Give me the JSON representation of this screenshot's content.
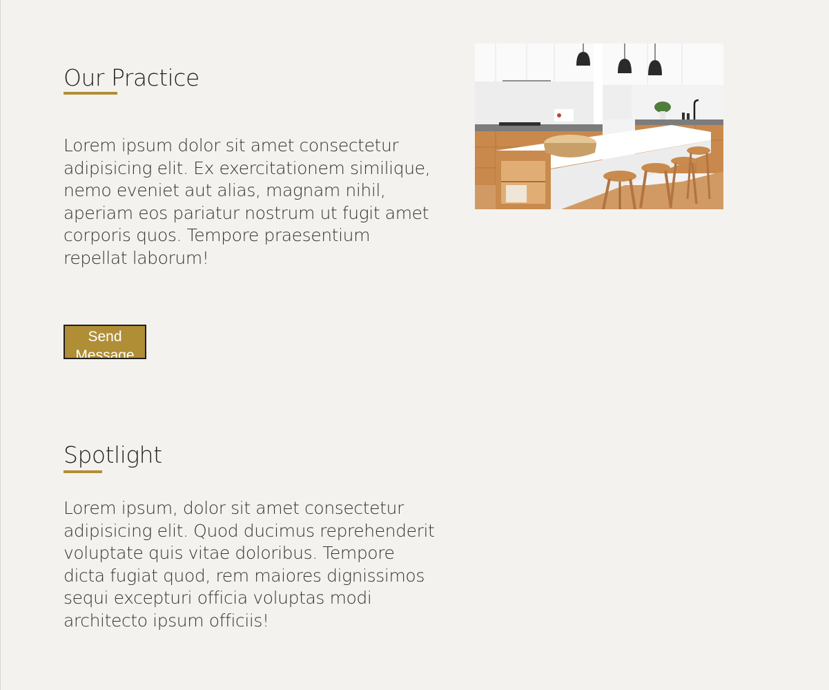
{
  "practice": {
    "heading": "Our Practice",
    "paragraph": "Lorem ipsum dolor sit amet consectetur adipisicing elit. Ex exercitationem similique, nemo eveniet aut alias, magnam nihil, aperiam eos pariatur nostrum ut fugit amet corporis quos. Tempore praesentium repellat laborum!",
    "button_label": "Send Message"
  },
  "spotlight": {
    "heading": "Spotlight",
    "paragraph": "Lorem ipsum, dolor sit amet consectetur adipisicing elit. Quod ducimus reprehenderit voluptate quis vitae doloribus. Tempore dicta fugiat quod, rem maiores dignissimos sequi excepturi officia voluptas modi architecto ipsum officiis!"
  },
  "colors": {
    "accent": "#b08e36",
    "background": "#f4f2ef",
    "text": "#2b2b2b"
  },
  "image": {
    "subject": "kitchen-interior-photo"
  }
}
